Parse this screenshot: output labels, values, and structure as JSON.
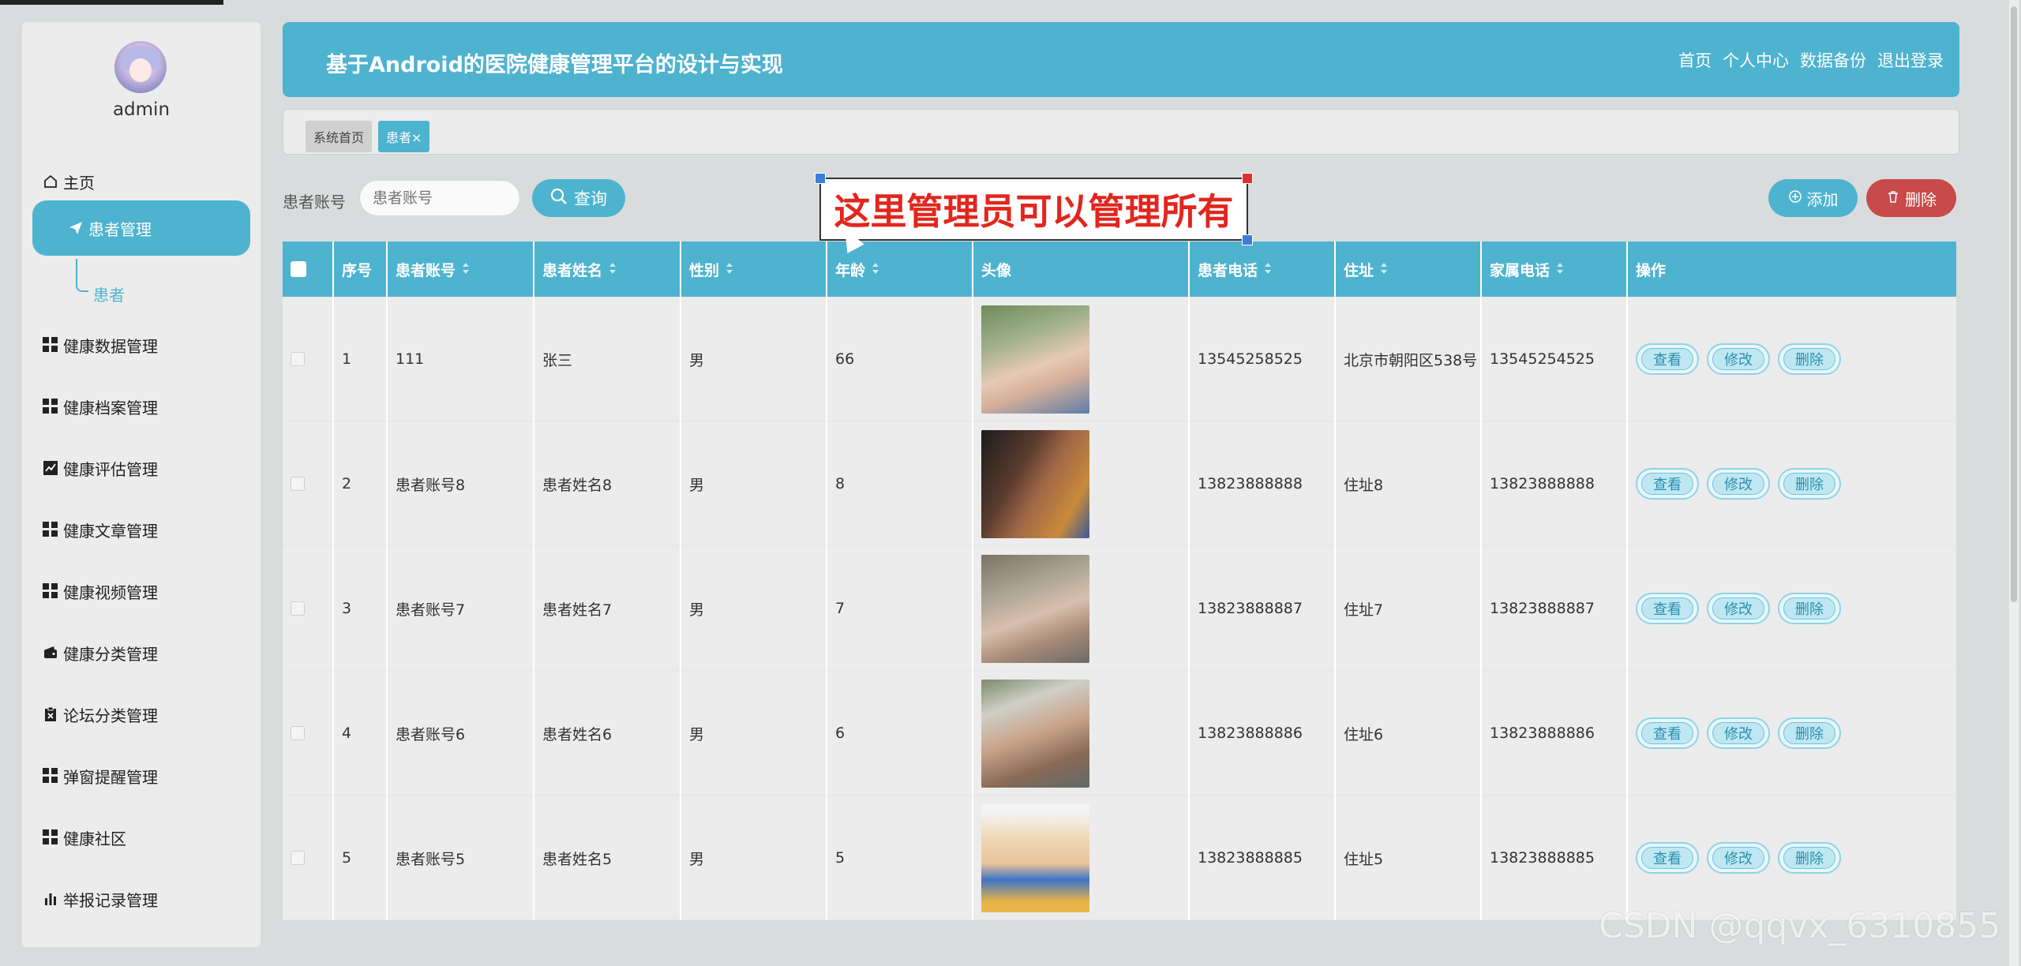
{
  "sidebar": {
    "username": "admin",
    "items": [
      {
        "label": "主页",
        "icon": "home-icon"
      },
      {
        "label": "患者管理",
        "icon": "paper-plane-icon"
      },
      {
        "label": "健康数据管理",
        "icon": "grid-icon"
      },
      {
        "label": "健康档案管理",
        "icon": "grid-icon"
      },
      {
        "label": "健康评估管理",
        "icon": "line-chart-icon"
      },
      {
        "label": "健康文章管理",
        "icon": "grid-icon"
      },
      {
        "label": "健康视频管理",
        "icon": "grid-icon"
      },
      {
        "label": "健康分类管理",
        "icon": "wallet-icon"
      },
      {
        "label": "论坛分类管理",
        "icon": "clipboard-icon"
      },
      {
        "label": "弹窗提醒管理",
        "icon": "grid-icon"
      },
      {
        "label": "健康社区",
        "icon": "grid-icon"
      },
      {
        "label": "举报记录管理",
        "icon": "bar-chart-icon"
      }
    ],
    "sub_item": "患者"
  },
  "header": {
    "title": "基于Android的医院健康管理平台的设计与实现",
    "links": [
      "首页",
      "个人中心",
      "数据备份",
      "退出登录"
    ]
  },
  "tabs": [
    "系统首页",
    "患者×"
  ],
  "search": {
    "label": "患者账号",
    "placeholder": "患者账号",
    "query_label": "查询",
    "add_label": "添加",
    "delete_label": "删除"
  },
  "annotation": "这里管理员可以管理所有",
  "table": {
    "headers": [
      "序号",
      "患者账号",
      "患者姓名",
      "性别",
      "年龄",
      "头像",
      "患者电话",
      "住址",
      "家属电话",
      "操作"
    ],
    "rows": [
      {
        "no": "1",
        "account": "111",
        "name": "张三",
        "gender": "男",
        "age": "66",
        "phone": "13545258525",
        "address": "北京市朝阳区538号",
        "family_phone": "13545254525"
      },
      {
        "no": "2",
        "account": "患者账号8",
        "name": "患者姓名8",
        "gender": "男",
        "age": "8",
        "phone": "13823888888",
        "address": "住址8",
        "family_phone": "13823888888"
      },
      {
        "no": "3",
        "account": "患者账号7",
        "name": "患者姓名7",
        "gender": "男",
        "age": "7",
        "phone": "13823888887",
        "address": "住址7",
        "family_phone": "13823888887"
      },
      {
        "no": "4",
        "account": "患者账号6",
        "name": "患者姓名6",
        "gender": "男",
        "age": "6",
        "phone": "13823888886",
        "address": "住址6",
        "family_phone": "13823888886"
      },
      {
        "no": "5",
        "account": "患者账号5",
        "name": "患者姓名5",
        "gender": "男",
        "age": "5",
        "phone": "13823888885",
        "address": "住址5",
        "family_phone": "13823888885"
      }
    ],
    "actions": [
      "查看",
      "修改",
      "删除"
    ]
  },
  "watermark": "CSDN @qqvx_6310855",
  "colors": {
    "accent": "#4eb3cf",
    "danger": "#c84a4a",
    "annotation": "#e2261e"
  }
}
